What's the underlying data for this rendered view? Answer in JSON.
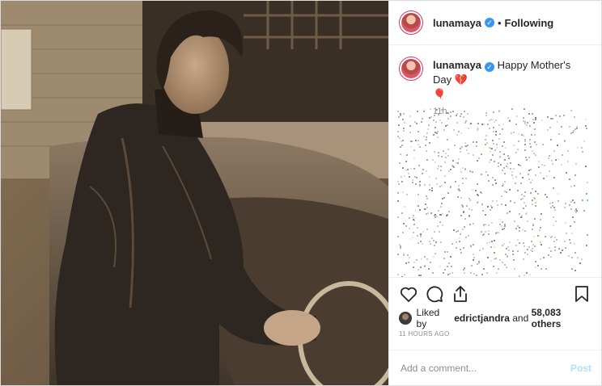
{
  "post": {
    "username": "lunamaya",
    "follow_status": "Following",
    "caption_text": "Happy Mother's Day",
    "caption_emoji_1": "💔",
    "caption_emoji_2": "🎈",
    "caption_time": "11h",
    "liked_by_prefix": "Liked by",
    "liked_by_user": "edrictjandra",
    "liked_by_and": "and",
    "liked_by_others": "58,083 others",
    "posted_ago": "11 HOURS AGO",
    "comment_placeholder": "Add a comment...",
    "post_label": "Post"
  },
  "icons": {
    "like": "heart-icon",
    "comment": "comment-icon",
    "share": "share-icon",
    "save": "bookmark-icon",
    "verified": "verified-badge-icon"
  },
  "colors": {
    "verified": "#3897f0",
    "post_button_disabled": "#b2dffc",
    "avatar_ring": "#e1306c",
    "muted_text": "#8e8e8e"
  }
}
